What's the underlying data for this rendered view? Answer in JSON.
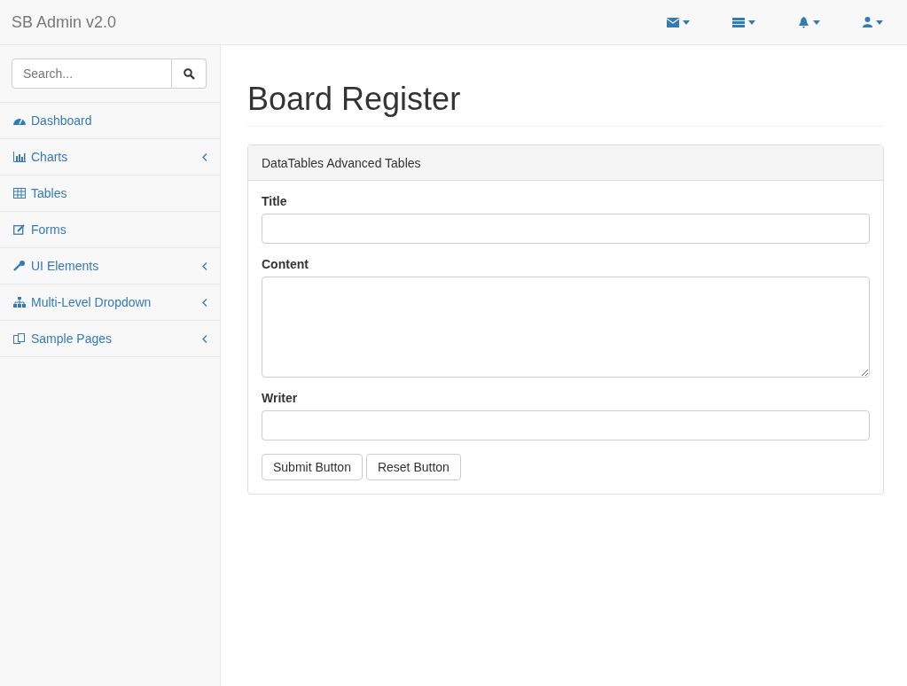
{
  "navbar": {
    "brand": "SB Admin v2.0",
    "menus": [
      {
        "kind": "envelope"
      },
      {
        "kind": "tasks"
      },
      {
        "kind": "bell"
      },
      {
        "kind": "user"
      }
    ]
  },
  "sidebar": {
    "search": {
      "placeholder": "Search..."
    },
    "items": [
      {
        "label": "Dashboard",
        "kind": "dashboard",
        "expandable": false
      },
      {
        "label": "Charts",
        "kind": "chart",
        "expandable": true
      },
      {
        "label": "Tables",
        "kind": "table",
        "expandable": false
      },
      {
        "label": "Forms",
        "kind": "edit",
        "expandable": false
      },
      {
        "label": "UI Elements",
        "kind": "wrench",
        "expandable": true
      },
      {
        "label": "Multi-Level Dropdown",
        "kind": "sitemap",
        "expandable": true
      },
      {
        "label": "Sample Pages",
        "kind": "files",
        "expandable": true
      }
    ]
  },
  "page": {
    "title": "Board Register",
    "panel": {
      "heading": "DataTables Advanced Tables",
      "fields": [
        {
          "label": "Title",
          "kind": "input"
        },
        {
          "label": "Content",
          "kind": "textarea"
        },
        {
          "label": "Writer",
          "kind": "input"
        }
      ],
      "buttons": [
        "Submit Button",
        "Reset Button"
      ]
    }
  }
}
